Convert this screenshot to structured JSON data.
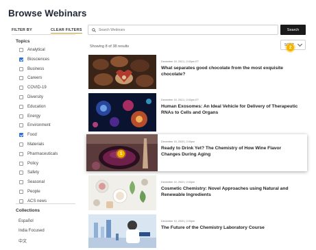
{
  "page": {
    "title": "Browse Webinars"
  },
  "filters": {
    "filter_by_label": "FILTER BY",
    "clear_label": "CLEAR FILTERS",
    "topics_heading": "Topics",
    "topics": [
      {
        "label": "Analytical",
        "checked": false
      },
      {
        "label": "Biosciences",
        "checked": true
      },
      {
        "label": "Business",
        "checked": false
      },
      {
        "label": "Careers",
        "checked": false
      },
      {
        "label": "COVID-19",
        "checked": false
      },
      {
        "label": "Diversity",
        "checked": false
      },
      {
        "label": "Education",
        "checked": false
      },
      {
        "label": "Energy",
        "checked": false
      },
      {
        "label": "Environment",
        "checked": false
      },
      {
        "label": "Food",
        "checked": true
      },
      {
        "label": "Materials",
        "checked": false
      },
      {
        "label": "Pharmaceuticals",
        "checked": false
      },
      {
        "label": "Policy",
        "checked": false
      },
      {
        "label": "Safety",
        "checked": false
      },
      {
        "label": "Seasonal",
        "checked": false
      },
      {
        "label": "People",
        "checked": false
      },
      {
        "label": "ACS news",
        "checked": false
      }
    ],
    "collections_heading": "Collections",
    "collections": [
      "Español",
      "India Focused",
      "中文"
    ]
  },
  "search": {
    "placeholder": "Search Webinars",
    "button_label": "Search"
  },
  "results": {
    "count_text": "Showing 8 of 38 results",
    "sort_label": "SORT"
  },
  "cards": [
    {
      "meta": "December 15, 2021 | 2:00pm ET",
      "title": "What separates good chocolate from the most exquisite chocolate?",
      "thumb": "chocolate-icon"
    },
    {
      "meta": "December 15, 2021 | 2:00pm ET",
      "title": "Human Exosomes: An Ideal Vehicle for Delivery of Therapeutic RNAs to Cells and Organs",
      "thumb": "cells-icon"
    },
    {
      "meta": "December 15, 2020 | 2:00pm",
      "title": "Ready to Drink Yet? The Chemistry of How Wine Flavor Changes During Aging",
      "thumb": "wine-icon"
    },
    {
      "meta": "December 10, 2020 | 2:00pm",
      "title": "Cosmetic Chemistry: Novel Approaches using Natural and Renewable Ingredients",
      "thumb": "cosmetics-icon"
    },
    {
      "meta": "December 10, 2020 | 2:00pm",
      "title": "The Future of the Chemistry Laboratory Course",
      "thumb": "laboratory-icon"
    }
  ],
  "badges": {
    "sort_step": "2",
    "card_step": "1"
  },
  "colors": {
    "accent": "#f5b400",
    "checkbox": "#2f6fd6",
    "button": "#1a1a1a"
  }
}
